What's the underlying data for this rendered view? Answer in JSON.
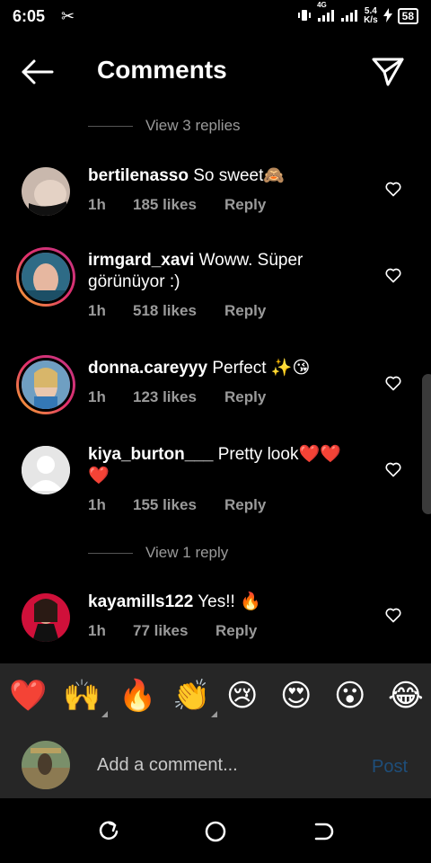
{
  "status_bar": {
    "time": "6:05",
    "network_type": "4G",
    "speed_value": "5.4",
    "speed_unit": "K/s",
    "battery": "58"
  },
  "header": {
    "title": "Comments"
  },
  "view_replies_top": "View 3 replies",
  "view_replies_bottom": "View 1 reply",
  "comments": [
    {
      "username": "bertilenasso",
      "text": "So sweet🙈",
      "time": "1h",
      "likes": "185 likes",
      "reply": "Reply"
    },
    {
      "username": "irmgard_xavi",
      "text": "Woww. Süper görünüyor :)",
      "time": "1h",
      "likes": "518 likes",
      "reply": "Reply"
    },
    {
      "username": "donna.careyyy",
      "text": "Perfect ✨😘",
      "time": "1h",
      "likes": "123 likes",
      "reply": "Reply"
    },
    {
      "username": "kiya_burton___",
      "text": "Pretty look❤️❤️❤️",
      "time": "1h",
      "likes": "155 likes",
      "reply": "Reply"
    },
    {
      "username": "kayamills122",
      "text": "Yes!! 🔥",
      "time": "1h",
      "likes": "77 likes",
      "reply": "Reply"
    }
  ],
  "reactions": [
    "❤️",
    "🙌",
    "🔥",
    "👏",
    "😢",
    "😍",
    "😮",
    "😂"
  ],
  "comment_input": {
    "placeholder": "Add a comment...",
    "post_label": "Post"
  },
  "colors": {
    "background": "#000000",
    "secondary_text": "#9a9a9a",
    "bar_background": "#262626",
    "post_disabled": "#1e4e7a",
    "story_ring": "#e1306c"
  },
  "icons": {
    "back": "arrow-left-icon",
    "share": "paper-plane-icon",
    "like": "heart-outline-icon",
    "nav": [
      "recents-icon",
      "home-icon",
      "back-nav-icon"
    ]
  }
}
